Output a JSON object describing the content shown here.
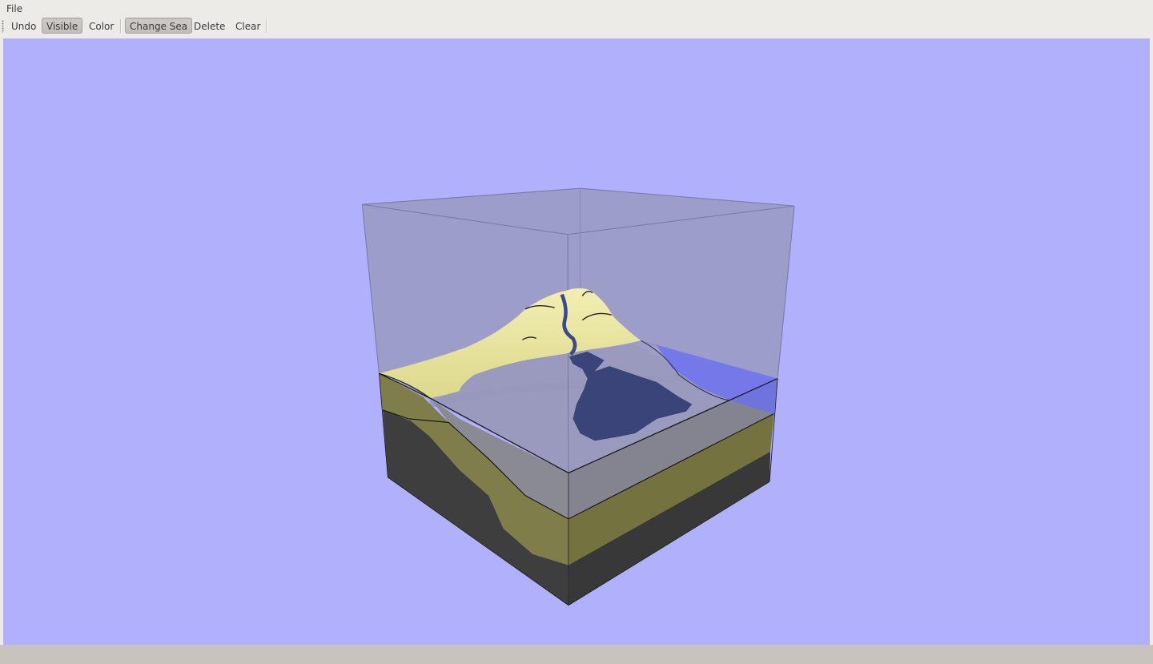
{
  "menubar": {
    "items": [
      {
        "label": "File"
      }
    ]
  },
  "toolbar": {
    "buttons": [
      {
        "label": "Undo",
        "checked": false
      },
      {
        "label": "Visible",
        "checked": true
      },
      {
        "label": "Color",
        "checked": false
      },
      {
        "label": "Change Sea",
        "checked": true
      },
      {
        "label": "Delete",
        "checked": false
      },
      {
        "label": "Clear",
        "checked": false
      }
    ]
  },
  "viewport": {
    "background_color": "#b0b0fc",
    "scene": "3d-geological-block-model",
    "colors": {
      "box_glass": "#9a9ac0",
      "terrain_land": "#e6e29a",
      "sea_water": "#7478e8",
      "sea_inner": "#3a4478",
      "layer_glass": "#8c8c94",
      "layer_sand": "#7e7c48",
      "layer_rock": "#3e3e3e"
    }
  },
  "statusbar": {
    "text": ""
  }
}
